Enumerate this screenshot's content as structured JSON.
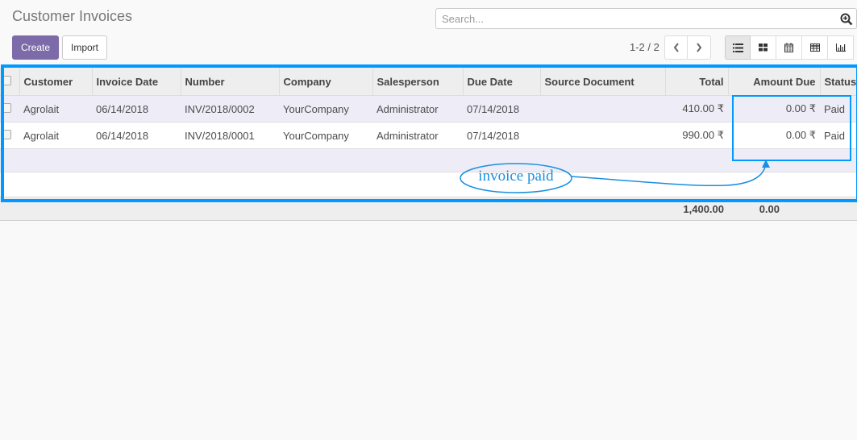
{
  "page_title": "Customer Invoices",
  "search": {
    "placeholder": "Search..."
  },
  "buttons": {
    "create": "Create",
    "import": "Import"
  },
  "pager": {
    "text": "1-2 / 2"
  },
  "views": [
    "list-view",
    "kanban-view",
    "calendar-view",
    "pivot-view",
    "graph-view"
  ],
  "table": {
    "columns": [
      "Customer",
      "Invoice Date",
      "Number",
      "Company",
      "Salesperson",
      "Due Date",
      "Source Document",
      "Total",
      "Amount Due",
      "Status"
    ],
    "rows": [
      {
        "customer": "Agrolait",
        "invoice_date": "06/14/2018",
        "number": "INV/2018/0002",
        "company": "YourCompany",
        "salesperson": "Administrator",
        "due_date": "07/14/2018",
        "source": "",
        "total": "410.00 ₹",
        "amount_due": "0.00 ₹",
        "status": "Paid"
      },
      {
        "customer": "Agrolait",
        "invoice_date": "06/14/2018",
        "number": "INV/2018/0001",
        "company": "YourCompany",
        "salesperson": "Administrator",
        "due_date": "07/14/2018",
        "source": "",
        "total": "990.00 ₹",
        "amount_due": "0.00 ₹",
        "status": "Paid"
      }
    ],
    "footer": {
      "total": "1,400.00",
      "amount_due": "0.00"
    }
  },
  "annotation": {
    "text": "invoice paid",
    "color": "#0099ff"
  }
}
